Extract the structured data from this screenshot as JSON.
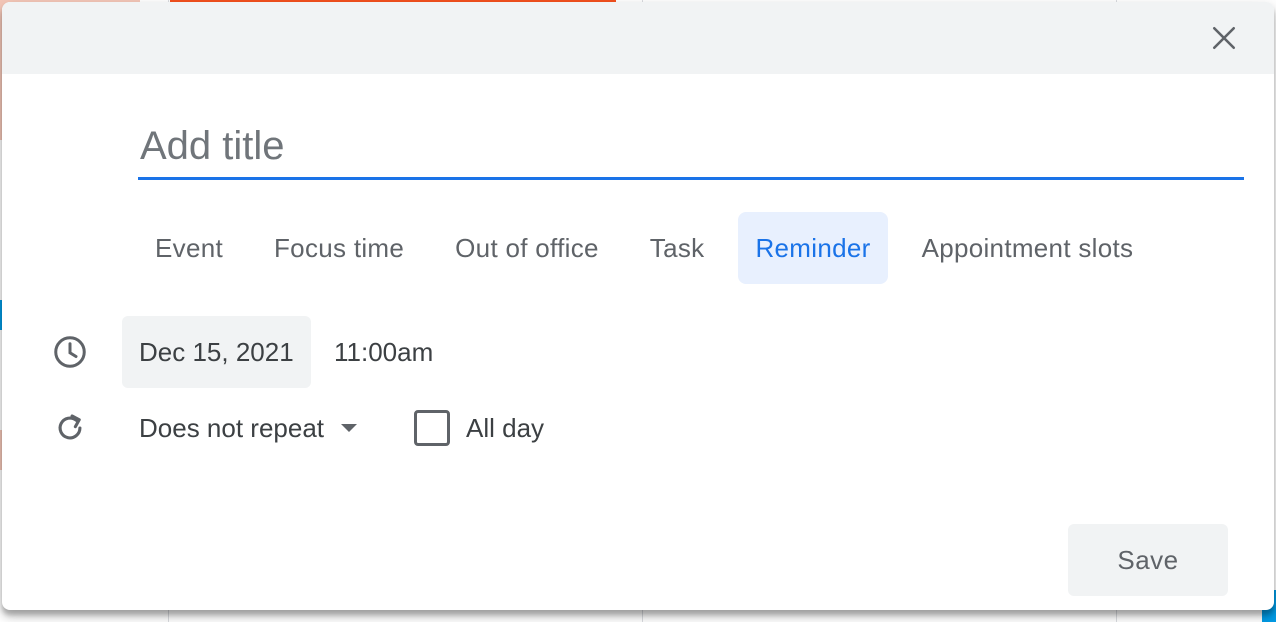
{
  "dialog": {
    "close_icon": "close-icon",
    "title_placeholder": "Add title",
    "title_value": ""
  },
  "tabs": [
    {
      "label": "Event",
      "active": false
    },
    {
      "label": "Focus time",
      "active": false
    },
    {
      "label": "Out of office",
      "active": false
    },
    {
      "label": "Task",
      "active": false
    },
    {
      "label": "Reminder",
      "active": true
    },
    {
      "label": "Appointment slots",
      "active": false
    }
  ],
  "datetime": {
    "icon": "clock-icon",
    "date": "Dec 15, 2021",
    "time": "11:00am"
  },
  "repeat": {
    "icon": "repeat-icon",
    "value": "Does not repeat",
    "all_day_label": "All day",
    "all_day_checked": false
  },
  "actions": {
    "save_label": "Save"
  },
  "colors": {
    "accent": "#1a73e8",
    "accent_bg": "#e8f0fe",
    "header_bg": "#f1f3f4",
    "text": "#3c4043",
    "muted": "#5f6368"
  }
}
